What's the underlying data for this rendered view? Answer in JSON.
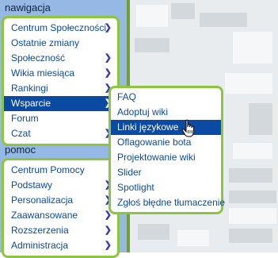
{
  "navigation": {
    "title": "nawigacja",
    "items": [
      {
        "label": "Centrum Społeczności",
        "has_submenu": true
      },
      {
        "label": "Ostatnie zmiany",
        "has_submenu": false
      },
      {
        "label": "Społeczność",
        "has_submenu": true
      },
      {
        "label": "Wikia miesiąca",
        "has_submenu": true
      },
      {
        "label": "Rankingi",
        "has_submenu": true
      },
      {
        "label": "Wsparcie",
        "has_submenu": true,
        "active": true
      },
      {
        "label": "Forum",
        "has_submenu": false
      },
      {
        "label": "Czat",
        "has_submenu": true
      }
    ]
  },
  "help": {
    "title": "pomoc",
    "items": [
      {
        "label": "Centrum Pomocy",
        "has_submenu": false
      },
      {
        "label": "Podstawy",
        "has_submenu": true
      },
      {
        "label": "Personalizacja",
        "has_submenu": true
      },
      {
        "label": "Zaawansowane",
        "has_submenu": true
      },
      {
        "label": "Rozszerzenia",
        "has_submenu": true
      },
      {
        "label": "Administracja",
        "has_submenu": true
      }
    ]
  },
  "submenu": {
    "items": [
      {
        "label": "FAQ"
      },
      {
        "label": "Adoptuj wiki"
      },
      {
        "label": "Linki językowe",
        "hovered": true
      },
      {
        "label": "Oflagowanie bota"
      },
      {
        "label": "Projektowanie wiki"
      },
      {
        "label": "Slider"
      },
      {
        "label": "Spotlight"
      },
      {
        "label": "Zgłoś błędne tłumaczenie"
      }
    ]
  },
  "icons": {
    "submenu_arrow": "chevron-right-icon",
    "cursor": "hand-pointer-icon"
  },
  "colors": {
    "sidebar_bg": "#95b9e4",
    "menu_border": "#8cc63f",
    "link": "#0a4aa2",
    "active_bg": "#0a4aa2",
    "chevron": "#3a3db4"
  }
}
